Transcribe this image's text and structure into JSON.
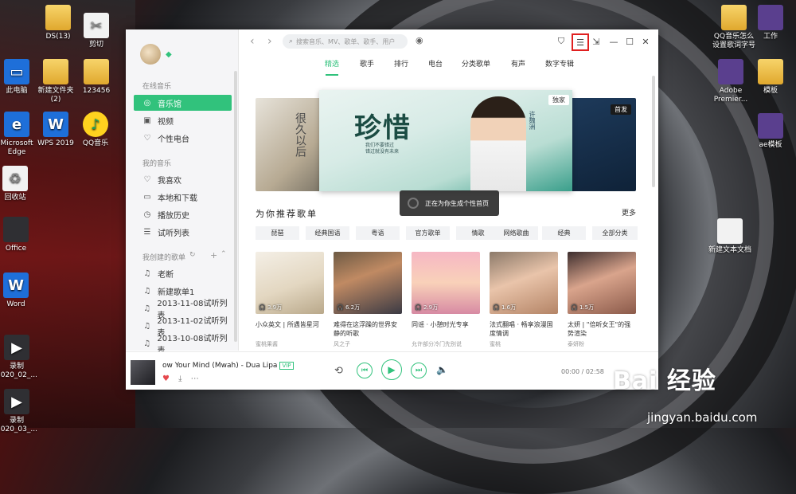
{
  "desktop": {
    "icons": [
      {
        "label": "DS(13)"
      },
      {
        "label": "剪切"
      },
      {
        "label": "此电脑"
      },
      {
        "label": "新建文件夹\n(2)"
      },
      {
        "label": "123456"
      },
      {
        "label": "Microsoft\nEdge"
      },
      {
        "label": "WPS 2019"
      },
      {
        "label": "QQ音乐"
      },
      {
        "label": "回收站"
      },
      {
        "label": "Office"
      },
      {
        "label": "Word"
      },
      {
        "label": "录制\n2020_02_..."
      },
      {
        "label": "录制\n2020_03_..."
      },
      {
        "label": "QQ音乐怎么\n设置歌词字号"
      },
      {
        "label": "工作"
      },
      {
        "label": "Adobe\nPremier..."
      },
      {
        "label": "模板"
      },
      {
        "label": "ae模板"
      },
      {
        "label": "新建文本文档"
      }
    ]
  },
  "watermark": {
    "brand": "Bai 经验",
    "url": "jingyan.baidu.com"
  },
  "app": {
    "search_placeholder": "搜索音乐、MV、歌单、歌手、用户",
    "sidebar": {
      "online_section": "在线音乐",
      "online_items": [
        "音乐馆",
        "视频",
        "个性电台"
      ],
      "my_section": "我的音乐",
      "my_items": [
        "我喜欢",
        "本地和下载",
        "播放历史",
        "试听列表"
      ],
      "created_section": "我创建的歌单",
      "created_items": [
        "老断",
        "新建歌单1",
        "2013-11-08试听列表",
        "2013-11-02试听列表",
        "2013-10-08试听列表"
      ]
    },
    "tabs": [
      "精选",
      "歌手",
      "排行",
      "电台",
      "分类歌单",
      "有声",
      "数字专辑"
    ],
    "banner": {
      "title": "珍惜",
      "subtitle": "我们不要错过\n错过就没有未来",
      "artist": "许魏洲",
      "badge_exclusive": "独家",
      "badge_first": "首发",
      "left_text": "很久以后"
    },
    "toast": "正在为你生成个性首页",
    "recommend_title": "为你推荐歌单",
    "more": "更多",
    "chips": [
      "琵琶",
      "经典国语",
      "粤语",
      "官方歌单",
      "情歌",
      "网络歌曲",
      "经典",
      "全部分类"
    ],
    "cards": [
      {
        "plays": "3.9万",
        "title": "小众英文 | 所遇皆星河",
        "sub": "蜜桃果酱"
      },
      {
        "plays": "6.2万",
        "title": "难得在这浮躁的世界安静的听歌",
        "sub": "风之子"
      },
      {
        "plays": "2.9万",
        "title": "同谣 · 小憩时光专享",
        "sub": "允许部分冷门先别说"
      },
      {
        "plays": "1.6万",
        "title": "法式翻唱 · 畅享浪漫国度情调",
        "sub": "蜜桃"
      },
      {
        "plays": "1.5万",
        "title": "太妍 | \"倍听女王\"的强势渲染",
        "sub": "泰妍粉"
      }
    ],
    "player": {
      "title": "ow Your Mind (Mwah) - Dua Lipa",
      "vip": "VIP",
      "time": "00:00 / 02:58"
    }
  }
}
